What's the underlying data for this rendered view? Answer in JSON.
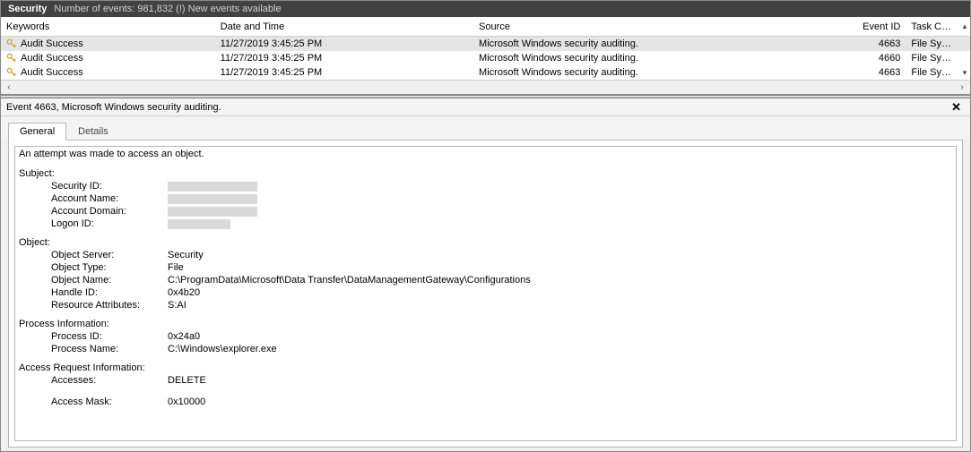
{
  "titlebar": {
    "main": "Security",
    "sub": "Number of events: 981,832 (!) New events available"
  },
  "columns": {
    "keywords": "Keywords",
    "date": "Date and Time",
    "source": "Source",
    "eventid": "Event ID",
    "taskcat": "Task Category"
  },
  "events": [
    {
      "keywords": "Audit Success",
      "date": "11/27/2019 3:45:25 PM",
      "source": "Microsoft Windows security auditing.",
      "eventid": "4663",
      "taskcat": "File System",
      "selected": true
    },
    {
      "keywords": "Audit Success",
      "date": "11/27/2019 3:45:25 PM",
      "source": "Microsoft Windows security auditing.",
      "eventid": "4660",
      "taskcat": "File System",
      "selected": false
    },
    {
      "keywords": "Audit Success",
      "date": "11/27/2019 3:45:25 PM",
      "source": "Microsoft Windows security auditing.",
      "eventid": "4663",
      "taskcat": "File System",
      "selected": false
    }
  ],
  "detail": {
    "header": "Event 4663, Microsoft Windows security auditing.",
    "tabs": {
      "general": "General",
      "details": "Details"
    },
    "message": "An attempt was made to access an object.",
    "subject": {
      "title": "Subject:",
      "security_id_label": "Security ID:",
      "account_name_label": "Account Name:",
      "account_domain_label": "Account Domain:",
      "logon_id_label": "Logon ID:"
    },
    "object": {
      "title": "Object:",
      "object_server_label": "Object Server:",
      "object_server_value": "Security",
      "object_type_label": "Object Type:",
      "object_type_value": "File",
      "object_name_label": "Object Name:",
      "object_name_value": "C:\\ProgramData\\Microsoft\\Data Transfer\\DataManagementGateway\\Configurations",
      "handle_id_label": "Handle ID:",
      "handle_id_value": "0x4b20",
      "resource_attr_label": "Resource Attributes:",
      "resource_attr_value": "S:AI"
    },
    "process": {
      "title": "Process Information:",
      "process_id_label": "Process ID:",
      "process_id_value": "0x24a0",
      "process_name_label": "Process Name:",
      "process_name_value": "C:\\Windows\\explorer.exe"
    },
    "access": {
      "title": "Access Request Information:",
      "accesses_label": "Accesses:",
      "accesses_value": "DELETE",
      "access_mask_label": "Access Mask:",
      "access_mask_value": "0x10000"
    }
  }
}
